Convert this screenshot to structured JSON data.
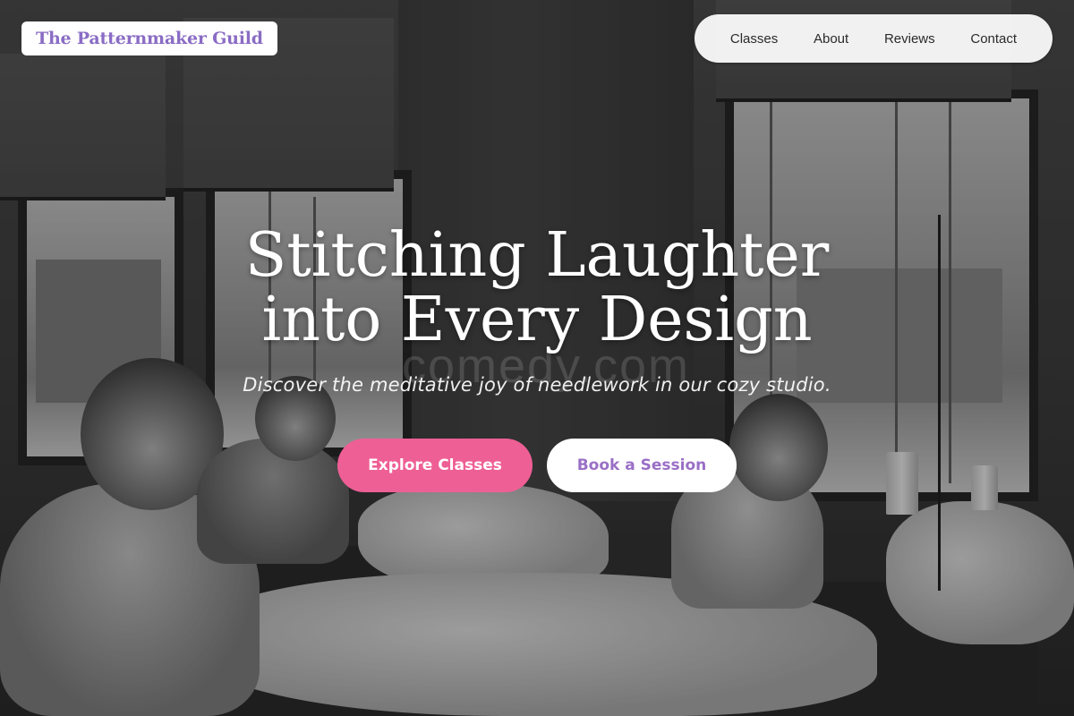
{
  "brand": {
    "name": "The Patternmaker Guild",
    "color": "#8a6cc4"
  },
  "nav": {
    "items": [
      {
        "label": "Classes"
      },
      {
        "label": "About"
      },
      {
        "label": "Reviews"
      },
      {
        "label": "Contact"
      }
    ]
  },
  "hero": {
    "title_line1": "Stitching Laughter",
    "title_line2": "into Every Design",
    "watermark": "comedy.com",
    "subtitle": "Discover the meditative joy of needlework in our cozy studio.",
    "primary_cta": "Explore Classes",
    "secondary_cta": "Book a Session",
    "background": "black-and-white photo of women sewing at machines by large windows"
  },
  "colors": {
    "primary_button": "#ee5f95",
    "secondary_button_text": "#9a6fc6"
  }
}
